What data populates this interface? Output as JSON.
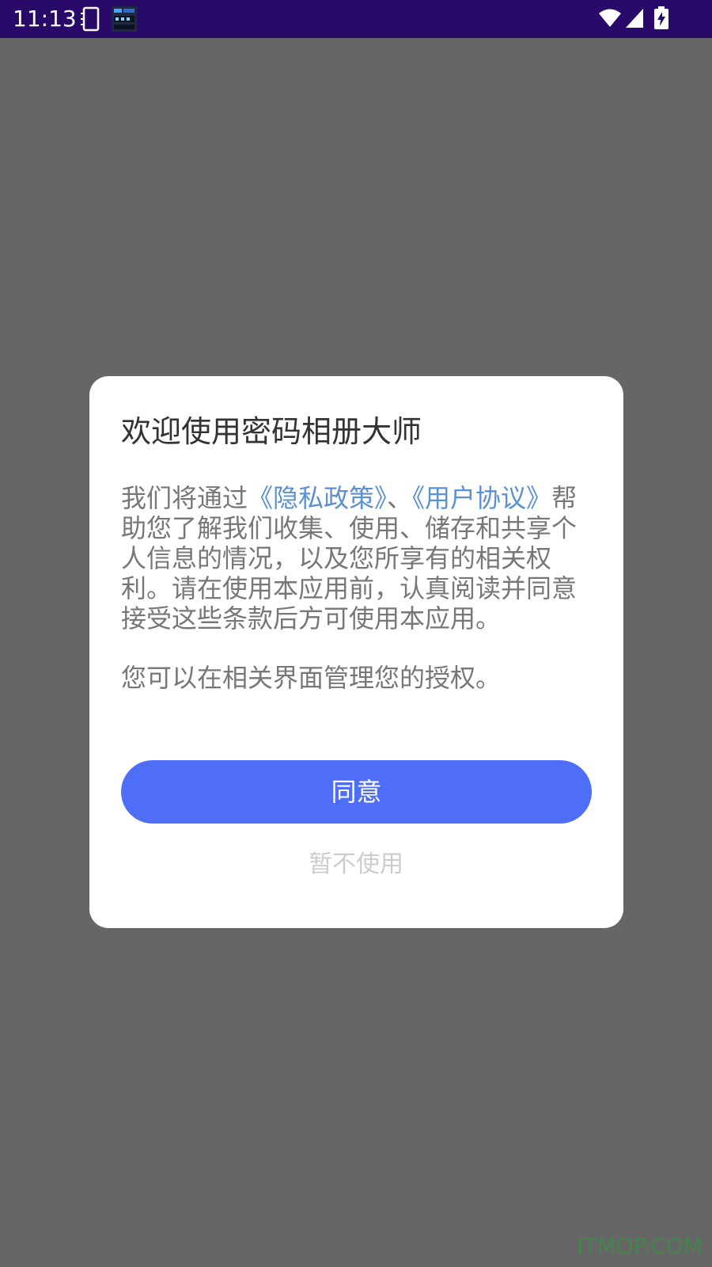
{
  "status_bar": {
    "time": "11:13",
    "background": "#2a0a68",
    "icons": [
      "notification-icon",
      "notification-icon",
      "wifi-icon",
      "signal-icon",
      "battery-charging-icon"
    ]
  },
  "dialog": {
    "title": "欢迎使用密码相册大师",
    "body": {
      "prefix": "我们将通过",
      "privacy_link": "《隐私政策》",
      "separator": "、",
      "agreement_link": "《用户协议》",
      "suffix": "帮助您了解我们收集、使用、储存和共享个人信息的情况，以及您所享有的相关权利。请在使用本应用前，认真阅读并同意接受这些条款后方可使用本应用。"
    },
    "note": "您可以在相关界面管理您的授权。",
    "agree_label": "同意",
    "decline_label": "暂不使用"
  },
  "colors": {
    "overlay": "#666666",
    "link": "#5b8fd6",
    "primary_button": "#4f6ef7"
  },
  "watermark": "ITMOP.COM"
}
